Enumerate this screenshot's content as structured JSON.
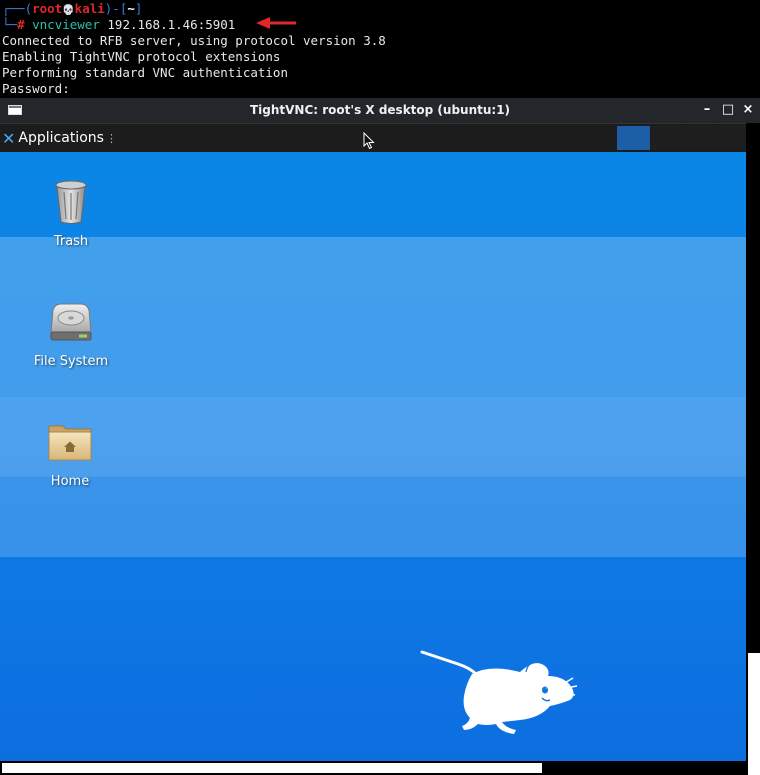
{
  "terminal": {
    "prompt_open": "┌──(",
    "prompt_user": "root",
    "prompt_skull": "💀",
    "prompt_host": "kali",
    "prompt_mid": ")-[",
    "prompt_dir": "~",
    "prompt_close": "]",
    "prompt_lead": "└─",
    "prompt_hash": "#",
    "command": "vncviewer",
    "command_arg": "192.168.1.46:5901",
    "output": [
      "Connected to RFB server, using protocol version 3.8",
      "Enabling TightVNC protocol extensions",
      "Performing standard VNC authentication",
      "Password:"
    ],
    "annotation_color": "#e02828"
  },
  "window": {
    "title": "TightVNC: root's X desktop (ubuntu:1)",
    "minimize_label": "–",
    "maximize_label": "□",
    "close_label": "×"
  },
  "panel": {
    "apps_label": "Applications",
    "grip": "⋮",
    "workspaces": [
      "active",
      "inactive",
      "inactive",
      "inactive"
    ],
    "workspace_active_color": "#1d5fa6"
  },
  "desktop": {
    "icons": [
      {
        "label": "Trash",
        "icon": "trash-icon"
      },
      {
        "label": "File System",
        "icon": "harddisk-icon"
      },
      {
        "label": "Home",
        "icon": "home-folder-icon"
      }
    ],
    "background_color": "#0d7fe6",
    "logo": "xfce-mouse-logo"
  }
}
